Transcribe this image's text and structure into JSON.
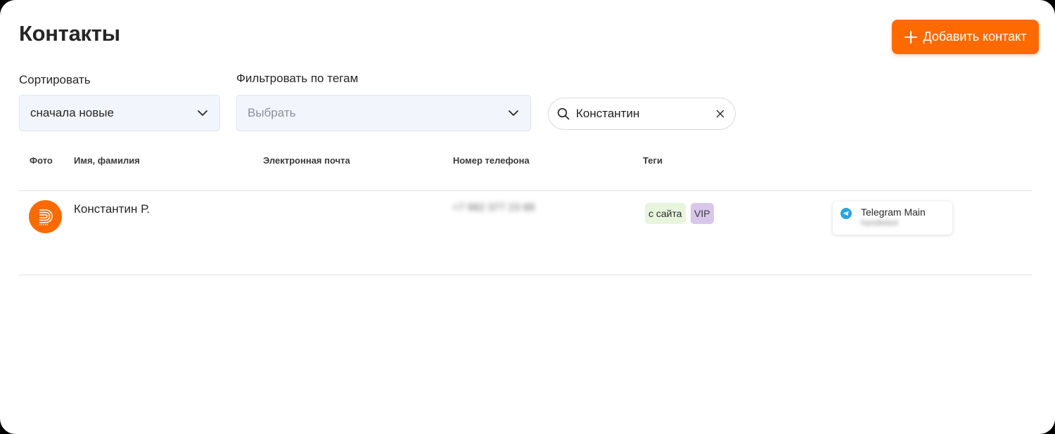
{
  "header": {
    "title": "Контакты",
    "add_button_label": "Добавить контакт"
  },
  "filters": {
    "sort": {
      "label": "Сортировать",
      "value": "сначала новые"
    },
    "tags": {
      "label": "Фильтровать по тегам",
      "placeholder": "Выбрать"
    },
    "search": {
      "value": "Константин"
    }
  },
  "table": {
    "columns": [
      "Фото",
      "Имя, фамилия",
      "Электронная почта",
      "Номер телефона",
      "Теги"
    ],
    "rows": [
      {
        "name": "Константин Р.",
        "email": "",
        "phone": "+7 982 377 23 88",
        "tags": [
          "с сайта",
          "VIP"
        ],
        "channel": {
          "name": "Telegram Main",
          "handle": "handlebot"
        }
      }
    ]
  },
  "colors": {
    "accent": "#ff6a00",
    "tag_site_bg": "#e8f5dd",
    "tag_vip_bg": "#d8c7ea",
    "telegram": "#2aa3df"
  }
}
